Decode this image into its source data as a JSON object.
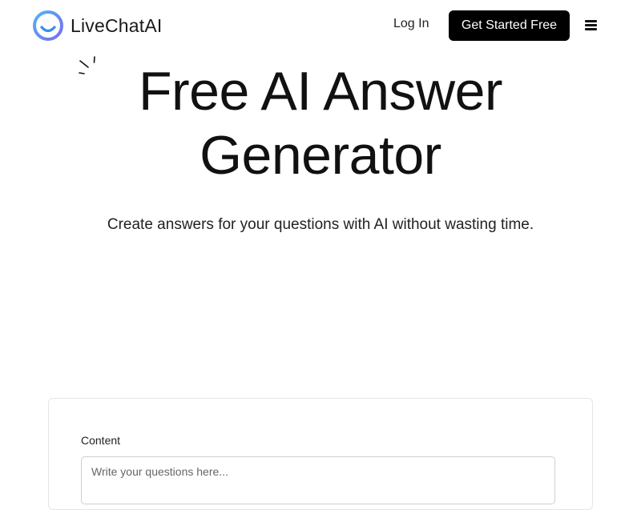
{
  "header": {
    "logo_text": "LiveChatAI",
    "login_label": "Log In",
    "cta_label": "Get Started Free",
    "menu_icon": "hamburger-menu-icon"
  },
  "colors": {
    "cta_background": "#000000",
    "logo_gradient_start": "#4fb4f5",
    "logo_gradient_end": "#7a6cf0"
  },
  "hero": {
    "title_line1": "Free AI Answer",
    "title_line2": "Generator",
    "subtitle": "Create answers for your questions with AI without wasting time."
  },
  "form": {
    "content_label": "Content",
    "content_placeholder": "Write your questions here...",
    "content_value": ""
  }
}
